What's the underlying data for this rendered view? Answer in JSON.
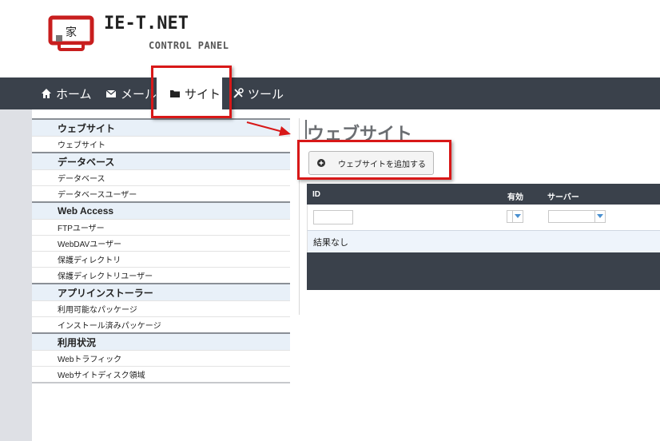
{
  "brand": {
    "logo_char": "家",
    "title": "IE-T.NET",
    "subtitle": "CONTROL PANEL"
  },
  "topnav": {
    "items": [
      {
        "label": "ホーム",
        "icon": "home-icon"
      },
      {
        "label": "メール",
        "icon": "mail-icon"
      },
      {
        "label": "サイト",
        "icon": "folder-icon",
        "active": true
      },
      {
        "label": "ツール",
        "icon": "tools-icon"
      }
    ]
  },
  "sidebar": {
    "sections": [
      {
        "title": "ウェブサイト",
        "items": [
          "ウェブサイト"
        ]
      },
      {
        "title": "データベース",
        "items": [
          "データベース",
          "データベースユーザー"
        ]
      },
      {
        "title": "Web Access",
        "items": [
          "FTPユーザー",
          "WebDAVユーザー",
          "保護ディレクトリ",
          "保護ディレクトリユーザー"
        ]
      },
      {
        "title": "アプリインストーラー",
        "items": [
          "利用可能なパッケージ",
          "インストール済みパッケージ"
        ]
      },
      {
        "title": "利用状況",
        "items": [
          "Webトラフィック",
          "Webサイトディスク領域"
        ]
      }
    ]
  },
  "main": {
    "title": "ウェブサイト",
    "add_button": "ウェブサイトを追加する",
    "grid": {
      "columns": [
        "ID",
        "有効",
        "サーバー"
      ],
      "empty_text": "結果なし"
    }
  },
  "colors": {
    "nav_bg": "#3a414b",
    "section_bg": "#e8f0f8",
    "annotation_red": "#d81818",
    "left_strip": "#dee0e5"
  }
}
